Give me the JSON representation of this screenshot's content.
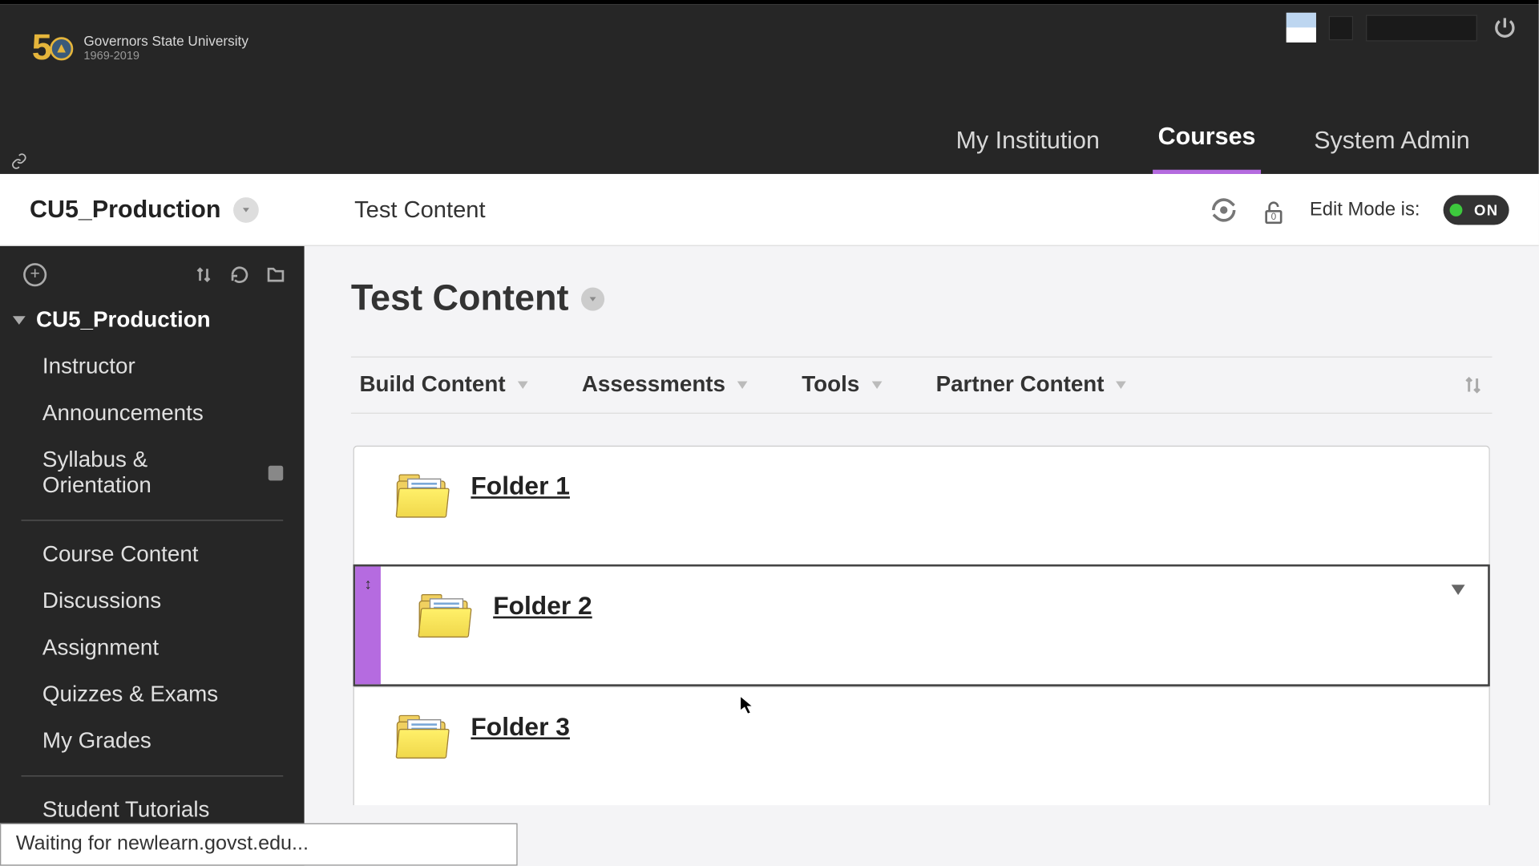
{
  "institution": {
    "name": "Governors State University",
    "years": "1969-2019"
  },
  "nav": {
    "my_institution": "My Institution",
    "courses": "Courses",
    "system_admin": "System Admin"
  },
  "breadcrumb": {
    "course": "CU5_Production",
    "page": "Test Content"
  },
  "edit_mode": {
    "label": "Edit Mode is:",
    "value": "ON"
  },
  "lock_count": "0",
  "sidebar": {
    "home": "CU5_Production",
    "items": [
      {
        "label": "Instructor"
      },
      {
        "label": "Announcements"
      },
      {
        "label": "Syllabus & Orientation",
        "badge": true
      }
    ],
    "items2": [
      {
        "label": "Course Content"
      },
      {
        "label": "Discussions"
      },
      {
        "label": "Assignment"
      },
      {
        "label": "Quizzes & Exams"
      },
      {
        "label": "My Grades"
      }
    ],
    "items3": [
      {
        "label": "Student Tutorials"
      }
    ]
  },
  "page_title": "Test Content",
  "actions": {
    "build": "Build Content",
    "assess": "Assessments",
    "tools": "Tools",
    "partner": "Partner Content"
  },
  "folders": [
    {
      "name": "Folder 1"
    },
    {
      "name": "Folder 2"
    },
    {
      "name": "Folder 3"
    }
  ],
  "status_text": "Waiting for newlearn.govst.edu..."
}
